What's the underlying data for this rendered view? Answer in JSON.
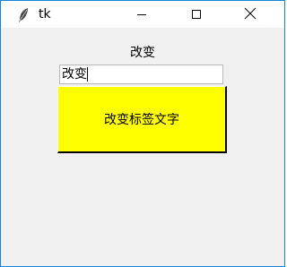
{
  "window": {
    "title": "tk",
    "minimize_icon": "minimize-icon",
    "maximize_icon": "maximize-icon",
    "close_icon": "close-icon",
    "app_icon": "feather-icon"
  },
  "main": {
    "label_text": "改变",
    "entry_value": "改变",
    "button_label": "改变标签文字"
  },
  "colors": {
    "button_bg": "#ffff00",
    "window_bg": "#f0f0f0",
    "border_accent": "#1883d7"
  }
}
